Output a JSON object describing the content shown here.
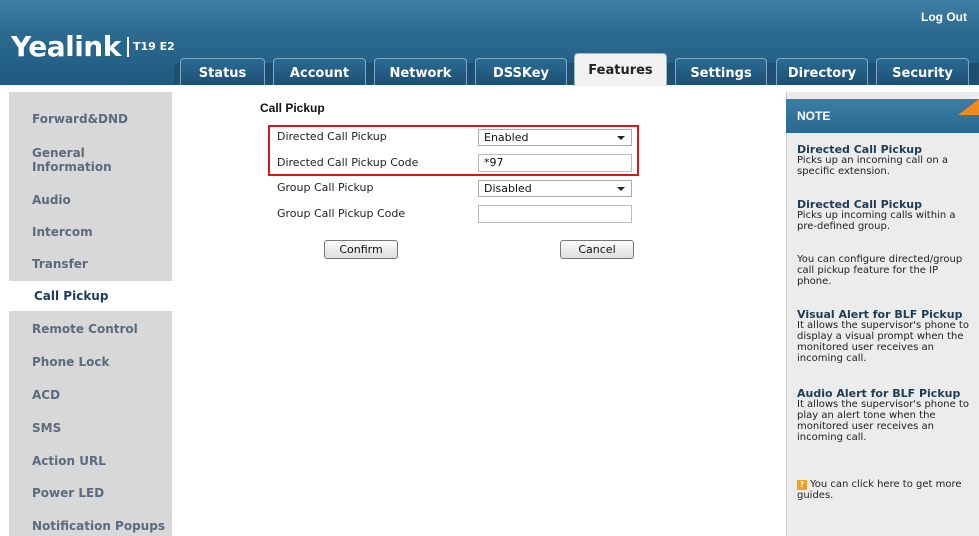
{
  "header": {
    "logo_text": "Yealink",
    "model": "T19 E2",
    "logout": "Log Out"
  },
  "tabs": [
    {
      "label": "Status",
      "active": false
    },
    {
      "label": "Account",
      "active": false
    },
    {
      "label": "Network",
      "active": false
    },
    {
      "label": "DSSKey",
      "active": false
    },
    {
      "label": "Features",
      "active": true
    },
    {
      "label": "Settings",
      "active": false
    },
    {
      "label": "Directory",
      "active": false
    },
    {
      "label": "Security",
      "active": false
    }
  ],
  "sidebar": {
    "items": [
      {
        "label": "Forward&DND"
      },
      {
        "label": "General\nInformation"
      },
      {
        "label": "Audio"
      },
      {
        "label": "Intercom"
      },
      {
        "label": "Transfer"
      },
      {
        "label": "Call Pickup",
        "active": true
      },
      {
        "label": "Remote Control"
      },
      {
        "label": "Phone Lock"
      },
      {
        "label": "ACD"
      },
      {
        "label": "SMS"
      },
      {
        "label": "Action URL"
      },
      {
        "label": "Power LED"
      },
      {
        "label": "Notification Popups"
      }
    ]
  },
  "form": {
    "section_title": "Call Pickup",
    "rows": [
      {
        "label": "Directed Call Pickup",
        "type": "select",
        "value": "Enabled"
      },
      {
        "label": "Directed Call Pickup Code",
        "type": "input",
        "value": "*97"
      },
      {
        "label": "Group Call Pickup",
        "type": "select",
        "value": "Disabled"
      },
      {
        "label": "Group Call Pickup Code",
        "type": "input",
        "value": ""
      }
    ],
    "confirm": "Confirm",
    "cancel": "Cancel"
  },
  "note": {
    "title": "NOTE",
    "blocks": [
      {
        "heading": "Directed Call Pickup",
        "text": "Picks up an incoming call on a specific extension."
      },
      {
        "heading": "Directed Call Pickup",
        "text": "Picks up incoming calls within a pre-defined group."
      },
      {
        "heading": "",
        "text": "You can configure directed/group call pickup feature for the IP phone."
      },
      {
        "heading": "Visual Alert for BLF Pickup",
        "text": "It allows the supervisor's phone to display a visual prompt when the monitored user receives an incoming call."
      },
      {
        "heading": "Audio Alert for BLF Pickup",
        "text": "It allows the supervisor's phone to play an alert tone when the monitored user receives an incoming call."
      },
      {
        "heading": "",
        "text": "You can click here to get more guides."
      }
    ],
    "help_icon": "?"
  }
}
